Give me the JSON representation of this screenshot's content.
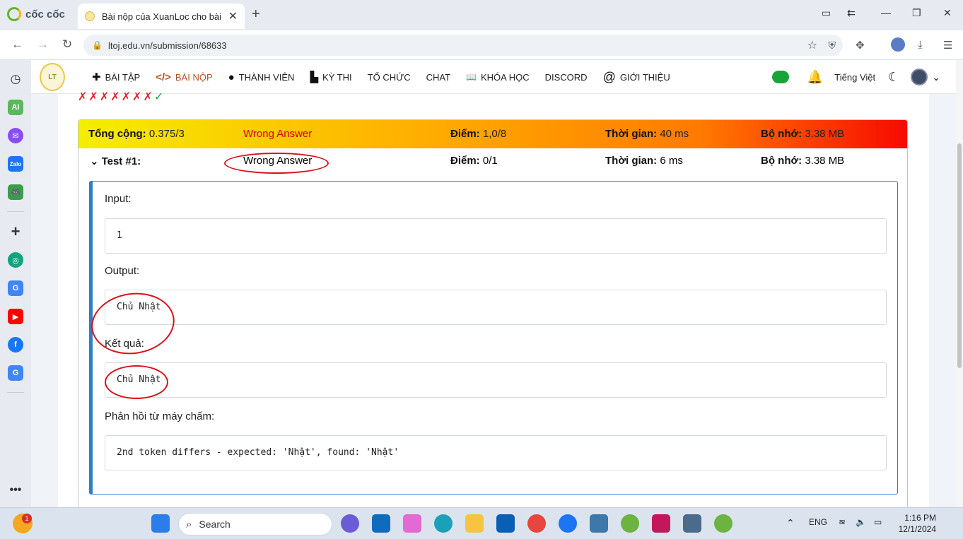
{
  "browser": {
    "brand": "cốc cốc",
    "tab_title": "Bài nộp của XuanLoc cho bài",
    "url": "ltoj.edu.vn/submission/68633"
  },
  "site": {
    "logo_text": "LT",
    "menu": [
      {
        "label": "BÀI TẬP",
        "icon": "puzzle-icon"
      },
      {
        "label": "BÀI NỘP",
        "icon": "code-icon"
      },
      {
        "label": "THÀNH VIÊN",
        "icon": "user-icon"
      },
      {
        "label": "KỲ THI",
        "icon": "podium-icon"
      },
      {
        "label": "TỔ CHỨC",
        "icon": ""
      },
      {
        "label": "CHAT",
        "icon": ""
      },
      {
        "label": "KHÓA HỌC",
        "icon": "book-icon"
      },
      {
        "label": "DISCORD",
        "icon": ""
      },
      {
        "label": "GIỚI THIỆU",
        "icon": "at-icon"
      }
    ],
    "language": "Tiếng Việt"
  },
  "submission": {
    "case_marks": [
      "✗",
      "✗",
      "✗",
      "✗",
      "✗",
      "✗",
      "✗",
      "✓"
    ],
    "total": {
      "label": "Tổng cộng:",
      "value": "0.375/3",
      "verdict": "Wrong Answer",
      "points_label": "Điểm:",
      "points": "1,0/8",
      "time_label": "Thời gian:",
      "time": "40 ms",
      "memory_label": "Bộ nhớ:",
      "memory": "3.38 MB"
    },
    "test1": {
      "label": "Test #1:",
      "verdict": "Wrong Answer",
      "points_label": "Điểm:",
      "points": "0/1",
      "time_label": "Thời gian:",
      "time": "6 ms",
      "memory_label": "Bộ nhớ:",
      "memory": "3.38 MB",
      "input_label": "Input:",
      "input": "1",
      "output_label": "Output:",
      "output": "Chủ Nhật",
      "expected_label": "Kết quả:",
      "expected": "Chủ Nhật",
      "feedback_label": "Phản hồi từ máy chấm:",
      "feedback": "2nd token differs - expected: 'Nhật', found: 'Nhật'"
    }
  },
  "taskbar": {
    "search_placeholder": "Search",
    "notification_count": "1",
    "lang": "ENG",
    "time": "1:16 PM",
    "date": "12/1/2024"
  }
}
